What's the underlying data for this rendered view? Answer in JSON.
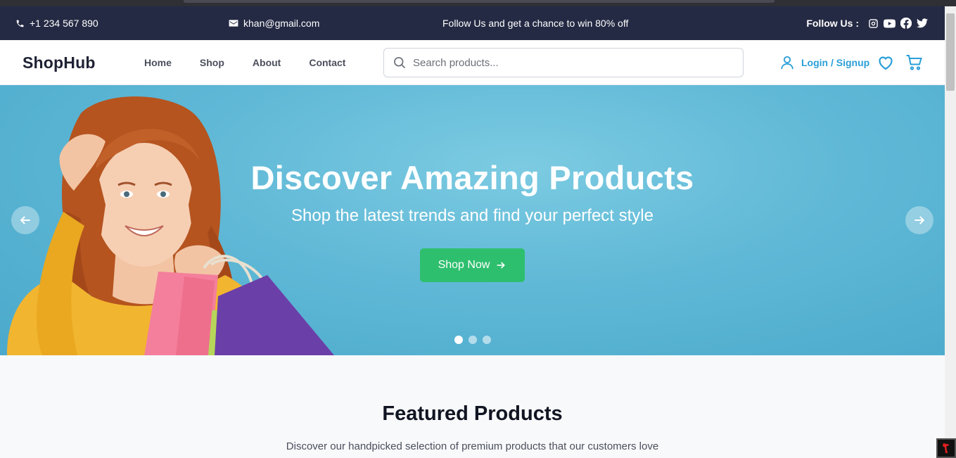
{
  "topbar": {
    "phone": "+1 234 567 890",
    "email": "khan@gmail.com",
    "promo": "Follow Us and get a chance to win 80% off",
    "follow_label": "Follow Us :",
    "socials": [
      "instagram-icon",
      "youtube-icon",
      "facebook-icon",
      "twitter-icon"
    ]
  },
  "nav": {
    "logo": "ShopHub",
    "menu": [
      "Home",
      "Shop",
      "About",
      "Contact"
    ],
    "search_placeholder": "Search products...",
    "login_label": "Login / Signup"
  },
  "hero": {
    "title": "Discover Amazing Products",
    "subtitle": "Shop the latest trends and find your perfect style",
    "cta_label": "Shop Now",
    "slide_count": 3,
    "active_slide": 1
  },
  "featured": {
    "title": "Featured Products",
    "subtitle": "Discover our handpicked selection of premium products that our customers love"
  },
  "colors": {
    "topbar_bg": "#252a44",
    "accent": "#2a9fd8",
    "cta": "#2ebf6e",
    "hero_bg": "#5fb8d6"
  }
}
